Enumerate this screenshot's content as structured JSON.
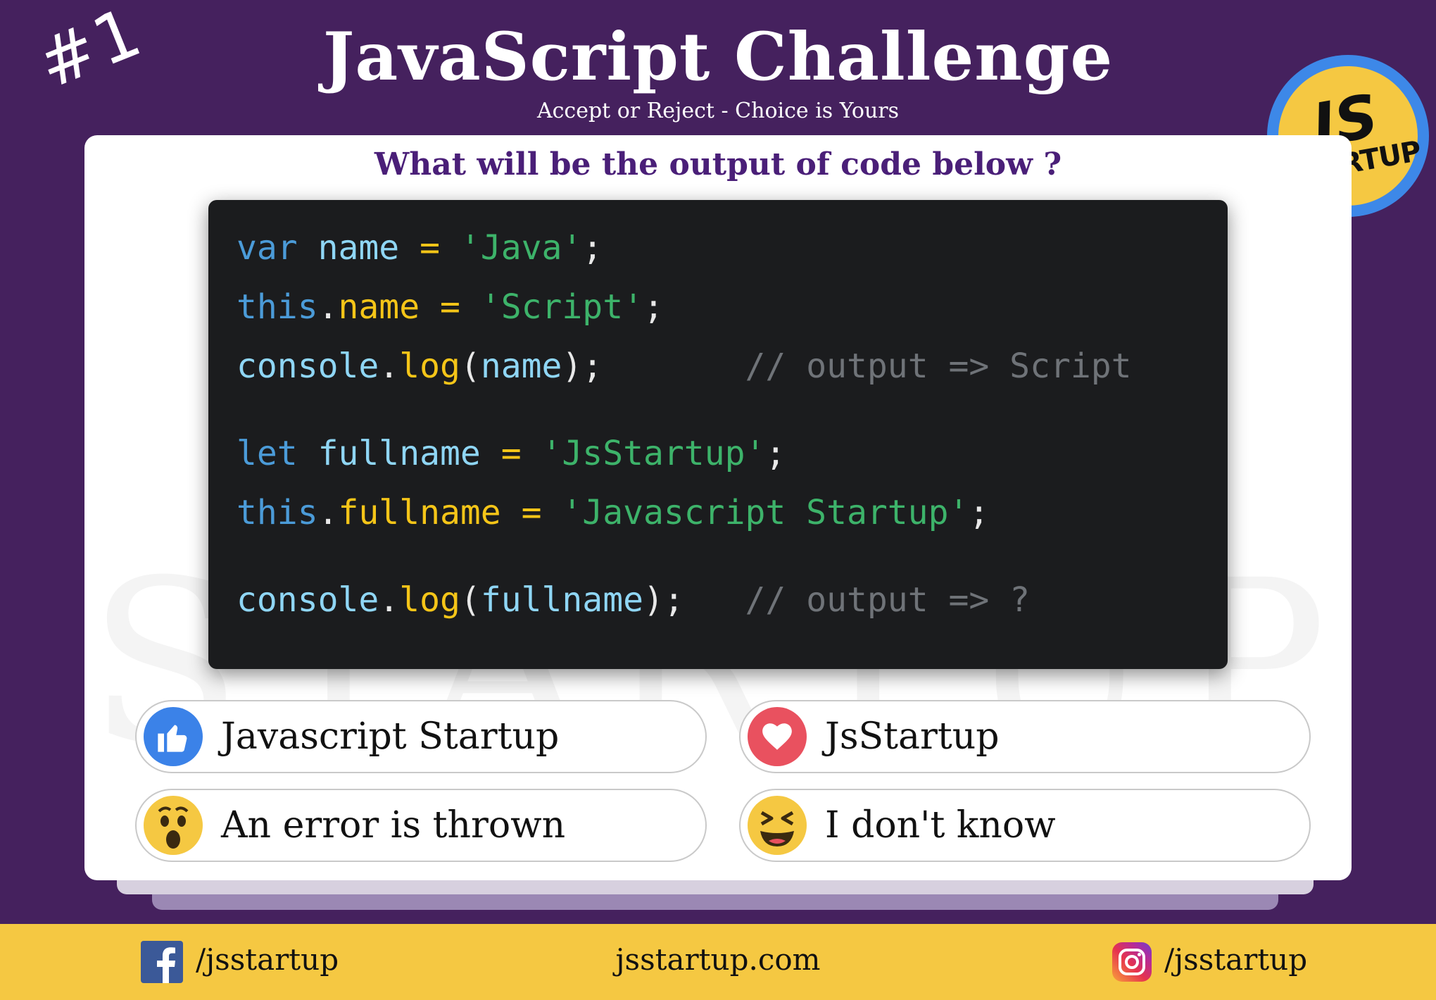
{
  "header": {
    "number": "#1",
    "title": "JavaScript Challenge",
    "subtitle": "Accept or Reject - Choice is Yours",
    "logo_top": "JS",
    "logo_bottom": "STARTUP"
  },
  "card": {
    "watermark": "JS STARTUP",
    "question": "What will be the output of code below ?",
    "code": {
      "line1": {
        "kw": "var",
        "sp1": " ",
        "id": "name",
        "op": " = ",
        "str": "'Java'",
        "end": ";"
      },
      "line2": {
        "kw": "this",
        "dot": ".",
        "prop": "name",
        "op": " = ",
        "str": "'Script'",
        "end": ";"
      },
      "line3": {
        "obj": "console",
        "dot": ".",
        "fn": "log",
        "open": "(",
        "arg": "name",
        "close": ");",
        "pad": "       ",
        "comment": "// output => Script"
      },
      "line4": {
        "kw": "let",
        "sp1": " ",
        "id": "fullname",
        "op": " = ",
        "str": "'JsStartup'",
        "end": ";"
      },
      "line5": {
        "kw": "this",
        "dot": ".",
        "prop": "fullname",
        "op": " = ",
        "str": "'Javascript Startup'",
        "end": ";"
      },
      "line6": {
        "obj": "console",
        "dot": ".",
        "fn": "log",
        "open": "(",
        "arg": "fullname",
        "close": ");",
        "pad": "   ",
        "comment": "// output => ?"
      }
    },
    "options": [
      {
        "icon": "thumbs-up-icon",
        "label": "Javascript Startup",
        "color": "#3b82e8"
      },
      {
        "icon": "heart-icon",
        "label": "JsStartup",
        "color": "#e9515f"
      },
      {
        "icon": "wow-face-icon",
        "label": "An error is thrown",
        "color": "#f5c842"
      },
      {
        "icon": "laughing-face-icon",
        "label": "I don't know",
        "color": "#f5c842"
      }
    ]
  },
  "footer": {
    "facebook": "/jsstartup",
    "website": "jsstartup.com",
    "instagram": "/jsstartup"
  },
  "colors": {
    "background": "#45215e",
    "footer": "#f5c842",
    "question": "#4a1f78",
    "code_bg": "#1b1c1e"
  }
}
